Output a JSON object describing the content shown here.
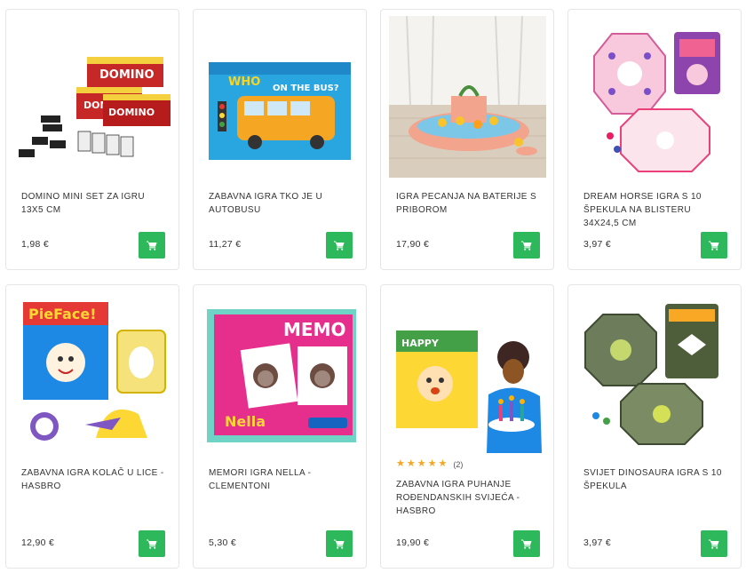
{
  "products": [
    {
      "title": "DOMINO MINI SET ZA IGRU 13x5 CM",
      "price": "1,98 €",
      "image": "domino-sets"
    },
    {
      "title": "ZABAVNA IGRA TKO JE U AUTOBUSU",
      "price": "11,27 €",
      "image": "who-on-the-bus-box"
    },
    {
      "title": "IGRA PECANJA NA BATERIJE S PRIBOROM",
      "price": "17,90 €",
      "image": "fishing-game"
    },
    {
      "title": "DREAM HORSE IGRA S 10 ŠPEKULA NA BLISTERU 34x24,5 CM",
      "price": "3,97 €",
      "image": "dream-horse-marbles"
    },
    {
      "title": "ZABAVNA IGRA KOLAČ U LICE - HASBRO",
      "price": "12,90 €",
      "image": "pie-face-game"
    },
    {
      "title": "MEMORI IGRA NELLA - CLEMENTONI",
      "price": "5,30 €",
      "image": "nella-memo-box"
    },
    {
      "title": "ZABAVNA IGRA PUHANJE ROĐENDANSKIH SVIJEĆA - HASBRO",
      "price": "19,90 €",
      "image": "birthday-candles-game",
      "rating": {
        "stars": 5,
        "count": "(2)"
      }
    },
    {
      "title": "SVIJET DINOSAURA IGRA S 10 ŠPEKULA",
      "price": "3,97 €",
      "image": "dinosaur-marbles"
    }
  ],
  "colors": {
    "cart_button": "#2eb85c",
    "star": "#f5a623",
    "card_border": "#e6e6e6"
  },
  "icons": {
    "cart": "shopping-cart-icon",
    "star": "star-icon"
  }
}
